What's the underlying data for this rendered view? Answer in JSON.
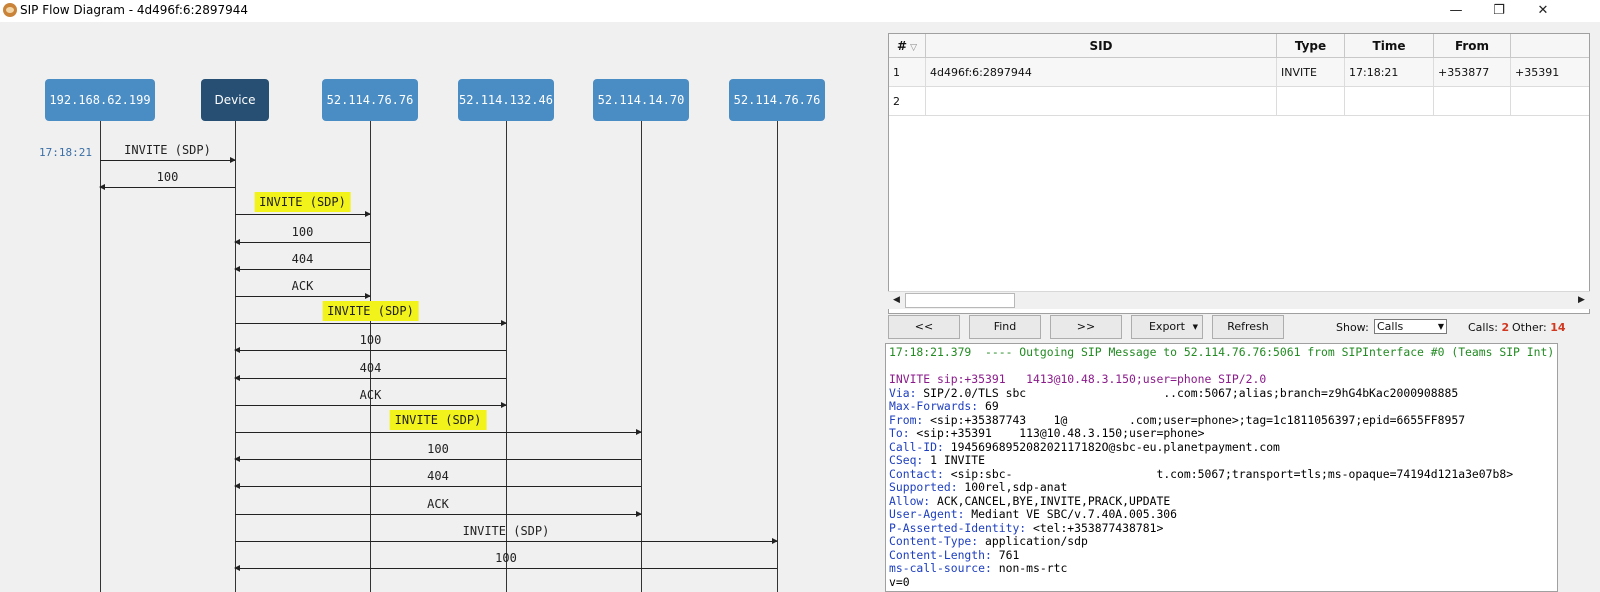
{
  "window": {
    "title": "SIP Flow Diagram - 4d496f:6:2897944",
    "minimize": "—",
    "restore": "❐",
    "close": "✕"
  },
  "diagram": {
    "endpoints": [
      {
        "label": "192.168.62.199"
      },
      {
        "label": "Device"
      },
      {
        "label": "52.114.76.76"
      },
      {
        "label": "52.114.132.46"
      },
      {
        "label": "52.114.14.70"
      },
      {
        "label": "52.114.76.76"
      }
    ],
    "time_label": "17:18:21",
    "messages": [
      {
        "label": "INVITE (SDP)",
        "from": 0,
        "to": 1,
        "highlight": false
      },
      {
        "label": "100",
        "from": 1,
        "to": 0,
        "highlight": false
      },
      {
        "label": "INVITE (SDP)",
        "from": 1,
        "to": 2,
        "highlight": true
      },
      {
        "label": "100",
        "from": 2,
        "to": 1,
        "highlight": false
      },
      {
        "label": "404",
        "from": 2,
        "to": 1,
        "highlight": false
      },
      {
        "label": "ACK",
        "from": 1,
        "to": 2,
        "highlight": false
      },
      {
        "label": "INVITE (SDP)",
        "from": 1,
        "to": 3,
        "highlight": true
      },
      {
        "label": "100",
        "from": 3,
        "to": 1,
        "highlight": false
      },
      {
        "label": "404",
        "from": 3,
        "to": 1,
        "highlight": false
      },
      {
        "label": "ACK",
        "from": 1,
        "to": 3,
        "highlight": false
      },
      {
        "label": "INVITE (SDP)",
        "from": 1,
        "to": 4,
        "highlight": true
      },
      {
        "label": "100",
        "from": 4,
        "to": 1,
        "highlight": false
      },
      {
        "label": "404",
        "from": 4,
        "to": 1,
        "highlight": false
      },
      {
        "label": "ACK",
        "from": 1,
        "to": 4,
        "highlight": false
      },
      {
        "label": "INVITE (SDP)",
        "from": 1,
        "to": 5,
        "highlight": false
      },
      {
        "label": "100",
        "from": 5,
        "to": 1,
        "highlight": false
      }
    ]
  },
  "grid": {
    "columns": [
      "#",
      "SID",
      "Type",
      "Time",
      "From"
    ],
    "rows": [
      {
        "num": "1",
        "sid": "4d496f:6:2897944",
        "type": "INVITE",
        "time": "17:18:21",
        "from": "+353877",
        "extra": "+35391"
      },
      {
        "num": "2",
        "sid": "",
        "type": "",
        "time": "",
        "from": "",
        "extra": ""
      }
    ],
    "scroll_left": "◀",
    "scroll_right": "▶"
  },
  "toolbar": {
    "prev": "<<",
    "find": "Find",
    "next": ">>",
    "export": "Export",
    "refresh": "Refresh",
    "show_label": "Show:",
    "show_value": "Calls",
    "calls_label": "Calls:",
    "calls_count": "2",
    "other_label": "Other:",
    "other_count": "14"
  },
  "log": {
    "lines": [
      {
        "text": "17:18:21.379  ---- Outgoing SIP Message to 52.114.76.76:5061 from SIPInterface #0 (Teams SIP Int) TLS",
        "color": "green"
      },
      {
        "text": "",
        "color": "black"
      },
      {
        "text": "INVITE sip:+35391   1413@10.48.3.150;user=phone SIP/2.0",
        "color": "purple"
      },
      {
        "key": "Via:",
        "value": " SIP/2.0/TLS sbc                    ..com:5067;alias;branch=z9hG4bKac2000908885"
      },
      {
        "key": "Max-Forwards:",
        "value": " 69"
      },
      {
        "key": "From:",
        "value": " <sip:+35387743    1@         .com;user=phone>;tag=1c1811056397;epid=6655FF8957"
      },
      {
        "key": "To:",
        "value": " <sip:+35391    113@10.48.3.150;user=phone>"
      },
      {
        "key": "Call-ID:",
        "value": " 1945696895208202117182O@sbc-eu.planetpayment.com"
      },
      {
        "key": "CSeq:",
        "value": " 1 INVITE"
      },
      {
        "key": "Contact:",
        "value": " <sip:sbc-                     t.com:5067;transport=tls;ms-opaque=74194d121a3e07b8>"
      },
      {
        "key": "Supported:",
        "value": " 100rel,sdp-anat"
      },
      {
        "key": "Allow:",
        "value": " ACK,CANCEL,BYE,INVITE,PRACK,UPDATE"
      },
      {
        "key": "User-Agent:",
        "value": " Mediant VE SBC/v.7.40A.005.306"
      },
      {
        "key": "P-Asserted-Identity:",
        "value": " <tel:+353877438781>"
      },
      {
        "key": "Content-Type:",
        "value": " application/sdp"
      },
      {
        "key": "Content-Length:",
        "value": " 761"
      },
      {
        "key": "ms-call-source:",
        "value": " non-ms-rtc"
      },
      {
        "text": "v=0",
        "color": "black"
      }
    ]
  }
}
